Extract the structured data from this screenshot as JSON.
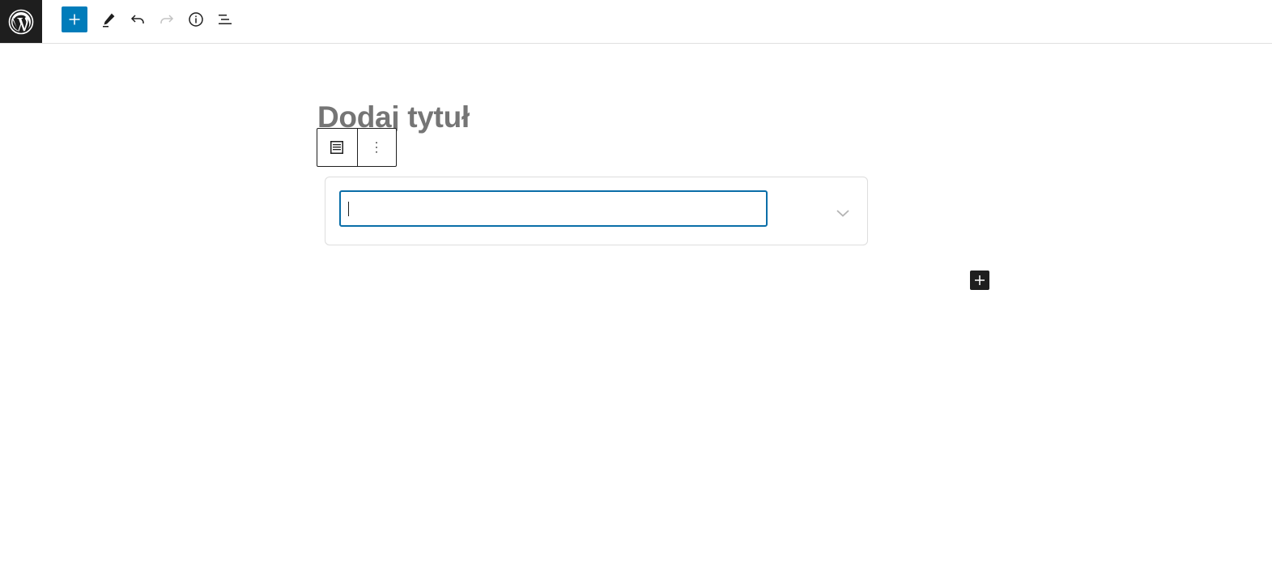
{
  "header": {
    "logo_icon": "wordpress-logo",
    "toolbar": [
      {
        "name": "add-block-button",
        "icon": "plus-icon"
      },
      {
        "name": "tools-button",
        "icon": "pencil-icon"
      },
      {
        "name": "undo-button",
        "icon": "undo-icon"
      },
      {
        "name": "redo-button",
        "icon": "redo-icon",
        "disabled": true
      },
      {
        "name": "details-button",
        "icon": "info-icon"
      },
      {
        "name": "list-view-button",
        "icon": "list-view-icon"
      }
    ]
  },
  "editor": {
    "title_placeholder": "Dodaj tytuł",
    "block_toolbar": {
      "block_icon": "table-of-contents-icon",
      "options_icon": "vertical-ellipsis-icon"
    },
    "embed": {
      "input_value": "",
      "input_placeholder": "",
      "toggle_icon": "chevron-down-icon"
    },
    "inserter_icon": "plus-icon"
  },
  "colors": {
    "accent": "#007cba",
    "dark": "#1e1e1e",
    "placeholder": "#757575",
    "input_border": "#0a6ea8"
  }
}
